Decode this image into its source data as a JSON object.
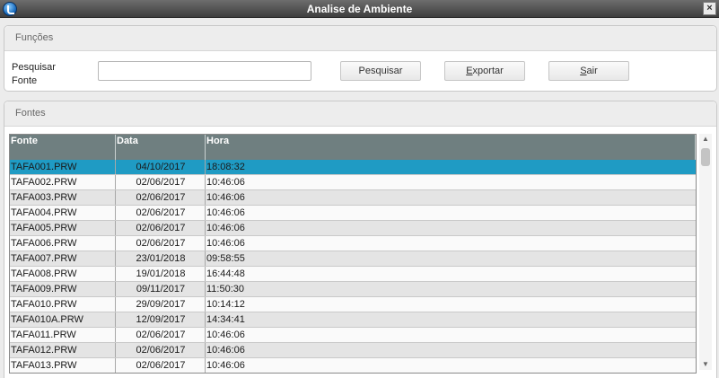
{
  "window": {
    "title": "Analise de Ambiente",
    "close_glyph": "×",
    "icon": "app-logo-icon"
  },
  "funcoes": {
    "title": "Funções",
    "search_label_line1": "Pesquisar",
    "search_label_line2": "Fonte",
    "search_value": "",
    "search_placeholder": "",
    "btn_pesquisar": "Pesquisar",
    "btn_exportar_mn": "E",
    "btn_exportar_rest": "xportar",
    "btn_sair_mn": "S",
    "btn_sair_rest": "air"
  },
  "fontes": {
    "title": "Fontes",
    "columns": [
      "Fonte",
      "Data",
      "Hora"
    ],
    "rows": [
      {
        "fonte": "TAFA001.PRW",
        "data": "04/10/2017",
        "hora": "18:08:32",
        "selected": true
      },
      {
        "fonte": "TAFA002.PRW",
        "data": "02/06/2017",
        "hora": "10:46:06"
      },
      {
        "fonte": "TAFA003.PRW",
        "data": "02/06/2017",
        "hora": "10:46:06"
      },
      {
        "fonte": "TAFA004.PRW",
        "data": "02/06/2017",
        "hora": "10:46:06"
      },
      {
        "fonte": "TAFA005.PRW",
        "data": "02/06/2017",
        "hora": "10:46:06"
      },
      {
        "fonte": "TAFA006.PRW",
        "data": "02/06/2017",
        "hora": "10:46:06"
      },
      {
        "fonte": "TAFA007.PRW",
        "data": "23/01/2018",
        "hora": "09:58:55"
      },
      {
        "fonte": "TAFA008.PRW",
        "data": "19/01/2018",
        "hora": "16:44:48"
      },
      {
        "fonte": "TAFA009.PRW",
        "data": "09/11/2017",
        "hora": "11:50:30"
      },
      {
        "fonte": "TAFA010.PRW",
        "data": "29/09/2017",
        "hora": "10:14:12"
      },
      {
        "fonte": "TAFA010A.PRW",
        "data": "12/09/2017",
        "hora": "14:34:41"
      },
      {
        "fonte": "TAFA011.PRW",
        "data": "02/06/2017",
        "hora": "10:46:06"
      },
      {
        "fonte": "TAFA012.PRW",
        "data": "02/06/2017",
        "hora": "10:46:06"
      },
      {
        "fonte": "TAFA013.PRW",
        "data": "02/06/2017",
        "hora": "10:46:06"
      }
    ]
  },
  "colors": {
    "header_bg": "#6f7f80",
    "selected_row": "#1f9bc4",
    "titlebar": "#4a4a4a"
  }
}
